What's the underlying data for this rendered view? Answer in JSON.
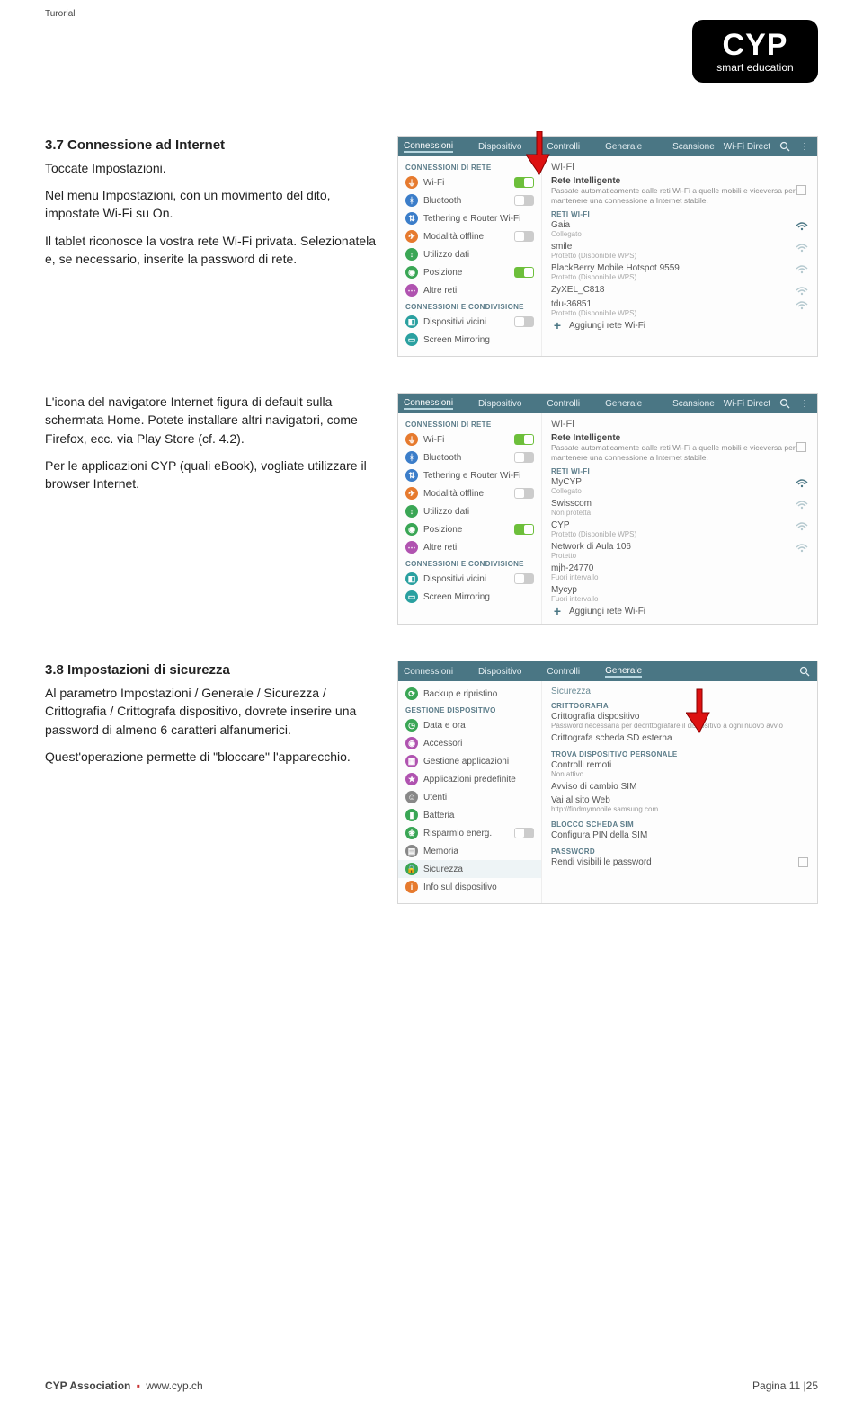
{
  "doc": {
    "corner": "Turorial",
    "logo_main": "CYP",
    "logo_sub": "smart education"
  },
  "footer": {
    "assoc": "CYP Association",
    "url": "www.cyp.ch",
    "page": "Pagina 11 |25"
  },
  "sec37": {
    "h": "3.7 Connessione ad Internet",
    "p1": "Toccate Impostazioni.",
    "p2": "Nel menu Impostazioni, con un movimento del dito, impostate Wi-Fi su On.",
    "p3": "Il tablet riconosce la vostra rete Wi-Fi privata. Selezionatela e, se necessario, inserite la password di rete."
  },
  "sec37b": {
    "p1": "L'icona del navigatore Internet figura di default sulla schermata Home. Potete installare altri navigatori, come Firefox, ecc. via Play Store (cf. 4.2).",
    "p2": "Per le applicazioni CYP (quali eBook), vogliate utilizzare il browser Internet."
  },
  "sec38": {
    "h": "3.8 Impostazioni di sicurezza",
    "p1": "Al parametro Impostazioni / Generale / Sicurezza / Crittografia / Crittografa dispositivo, dovrete inserire una password di almeno 6 caratteri alfanumerici.",
    "p2": "Quest'operazione permette di \"bloccare\" l'apparecchio."
  },
  "tabs": {
    "conn": "Connessioni",
    "disp": "Dispositivo",
    "ctrl": "Controlli",
    "gen": "Generale",
    "scan": "Scansione",
    "wdir": "Wi-Fi Direct"
  },
  "side": {
    "head_conn": "CONNESSIONI DI RETE",
    "wifi": "Wi-Fi",
    "bt": "Bluetooth",
    "teth": "Tethering e Router Wi-Fi",
    "offline": "Modalità offline",
    "dati": "Utilizzo dati",
    "pos": "Posizione",
    "altre": "Altre reti",
    "head_cond": "CONNESSIONI E CONDIVISIONE",
    "vicini": "Dispositivi vicini",
    "mirror": "Screen Mirroring"
  },
  "panel1": {
    "main_head": "Wi-Fi",
    "intel_t": "Rete Intelligente",
    "intel_d": "Passate automaticamente dalle reti Wi-Fi a quelle mobili e viceversa per mantenere una connessione a Internet stabile.",
    "sec_head": "RETI WI-FI",
    "nets": [
      {
        "name": "Gaia",
        "sub": "Collegato",
        "icon": "wifi",
        "strong": true
      },
      {
        "name": "smile",
        "sub": "Protetto (Disponibile WPS)",
        "icon": "wifi"
      },
      {
        "name": "BlackBerry Mobile Hotspot 9559",
        "sub": "Protetto (Disponibile WPS)",
        "icon": "wifi"
      },
      {
        "name": "ZyXEL_C818",
        "sub": "",
        "icon": "wifi"
      },
      {
        "name": "tdu-36851",
        "sub": "Protetto (Disponibile WPS)",
        "icon": "wifi"
      }
    ],
    "add": "Aggiungi rete Wi-Fi"
  },
  "panel2": {
    "main_head": "Wi-Fi",
    "intel_t": "Rete Intelligente",
    "intel_d": "Passate automaticamente dalle reti Wi-Fi a quelle mobili e viceversa per mantenere una connessione a Internet stabile.",
    "sec_head": "RETI WI-FI",
    "nets": [
      {
        "name": "MyCYP",
        "sub": "Collegato",
        "icon": "wifi",
        "strong": true
      },
      {
        "name": "Swisscom",
        "sub": "Non protetta",
        "icon": "wifi"
      },
      {
        "name": "CYP",
        "sub": "Protetto (Disponibile WPS)",
        "icon": "wifi"
      },
      {
        "name": "Network di Aula 106",
        "sub": "Protetto",
        "icon": "wifi"
      },
      {
        "name": "mjh-24770",
        "sub": "Fuori intervallo",
        "icon": "none"
      },
      {
        "name": "Mycyp",
        "sub": "Fuori intervallo",
        "icon": "none"
      }
    ],
    "add": "Aggiungi rete Wi-Fi"
  },
  "side_gen": {
    "head_disp": "GESTIONE DISPOSITIVO",
    "backup": "Backup e ripristino",
    "data": "Data e ora",
    "access": "Accessori",
    "gestapp": "Gestione applicazioni",
    "pred": "Applicazioni predefinite",
    "utenti": "Utenti",
    "batt": "Batteria",
    "energ": "Risparmio energ.",
    "mem": "Memoria",
    "sicur": "Sicurezza",
    "info": "Info sul dispositivo"
  },
  "panel3": {
    "head": "Sicurezza",
    "critto_head": "CRITTOGRAFIA",
    "critto_label": "Crittografia dispositivo",
    "critto_desc": "Password necessaria per decrittografare il dispositivo a ogni nuovo avvio",
    "sd": "Crittografa scheda SD esterna",
    "trova_head": "TROVA DISPOSITIVO PERSONALE",
    "remoti": "Controlli remoti",
    "remoti_sub": "Non attivo",
    "sim": "Avviso di cambio SIM",
    "web": "Vai al sito Web",
    "web_sub": "http://findmymobile.samsung.com",
    "blocco_head": "BLOCCO SCHEDA SIM",
    "pin": "Configura PIN della SIM",
    "pwd_head": "PASSWORD",
    "pwd_label": "Rendi visibili le password"
  }
}
